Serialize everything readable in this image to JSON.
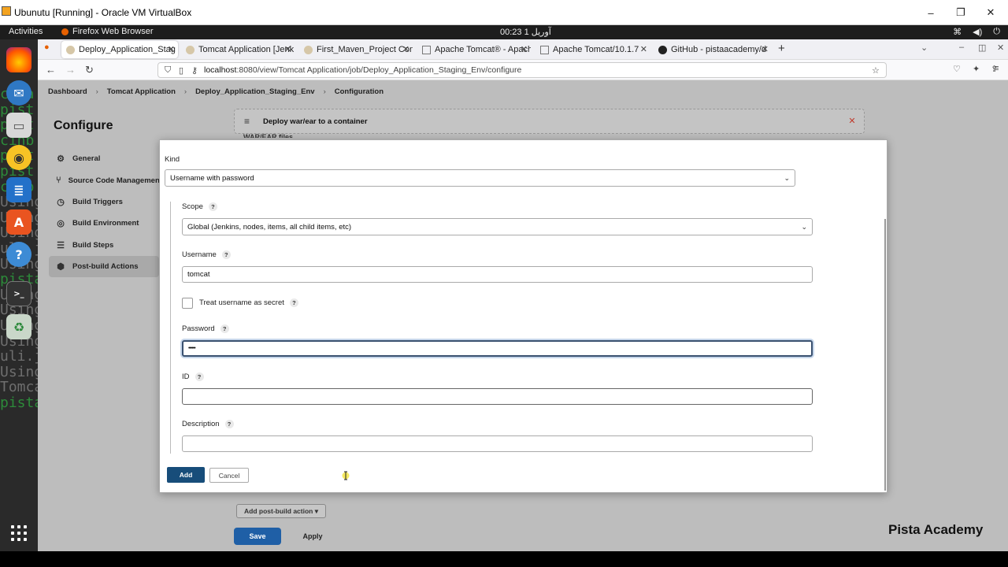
{
  "vbox": {
    "title": "Ubunutu [Running] - Oracle VM VirtualBox"
  },
  "gnome": {
    "activities": "Activities",
    "app": "Firefox Web Browser",
    "clock": "00:23  آوریل 1"
  },
  "dock": {
    "terminal_lines": [
      "cata",
      "pist",
      "pist",
      "cinb",
      "pist",
      "pist",
      "cinb",
      "Using",
      "Using",
      "Using",
      "uli.j",
      "Using",
      "pista",
      "Using",
      "Using",
      "Using",
      "Using",
      "uli.j",
      "Using",
      "Tomca",
      "pista"
    ]
  },
  "tabs": [
    {
      "title": "Deploy_Application_Stag"
    },
    {
      "title": "Tomcat Application [Jenk"
    },
    {
      "title": "First_Maven_Project Con"
    },
    {
      "title": "Apache Tomcat® - Apach"
    },
    {
      "title": "Apache Tomcat/10.1.7"
    },
    {
      "title": "GitHub - pistaacademy/d"
    }
  ],
  "url": {
    "host": "localhost",
    "path": ":8080/view/Tomcat Application/job/Deploy_Application_Staging_Env/configure"
  },
  "breadcrumb": [
    "Dashboard",
    "Tomcat Application",
    "Deploy_Application_Staging_Env",
    "Configuration"
  ],
  "config": {
    "title": "Configure",
    "sidebar": [
      {
        "label": "General",
        "icon": "gear-icon"
      },
      {
        "label": "Source Code Management",
        "icon": "branch-icon"
      },
      {
        "label": "Build Triggers",
        "icon": "clock-icon"
      },
      {
        "label": "Build Environment",
        "icon": "globe-icon"
      },
      {
        "label": "Build Steps",
        "icon": "list-icon"
      },
      {
        "label": "Post-build Actions",
        "icon": "box-icon"
      }
    ],
    "postbuild_card": {
      "header": "Deploy war/ear to a container",
      "sub": "WAR/EAR files"
    },
    "add_post_build": "Add post-build action ▾",
    "save": "Save",
    "apply": "Apply"
  },
  "dialog": {
    "kind_label": "Kind",
    "kind_value": "Username with password",
    "scope_label": "Scope",
    "scope_value": "Global (Jenkins, nodes, items, all child items, etc)",
    "username_label": "Username",
    "username_value": "tomcat",
    "secret_label": "Treat username as secret",
    "password_label": "Password",
    "password_value": "••••••",
    "id_label": "ID",
    "id_value": "",
    "description_label": "Description",
    "description_value": "",
    "add": "Add",
    "cancel": "Cancel"
  },
  "watermark": "Pista Academy",
  "colors": {
    "save": "#1f5fa6",
    "add": "#174d7a",
    "focus": "#3a5170"
  }
}
